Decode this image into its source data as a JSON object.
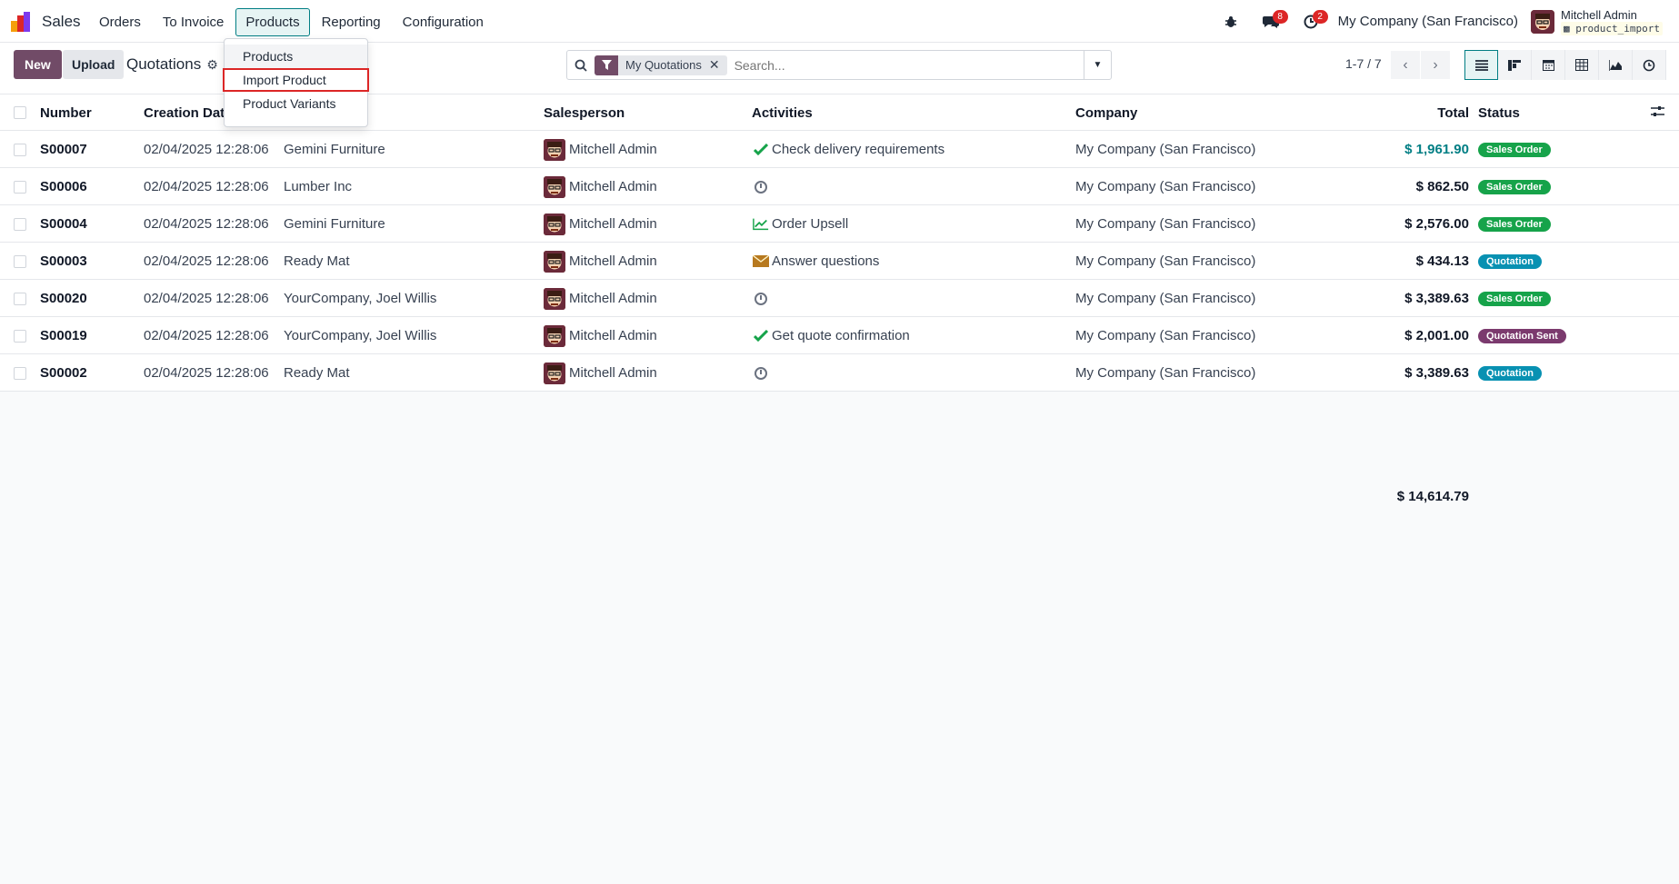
{
  "app": {
    "brand": "Sales"
  },
  "menu": [
    {
      "label": "Orders"
    },
    {
      "label": "To Invoice"
    },
    {
      "label": "Products"
    },
    {
      "label": "Reporting"
    },
    {
      "label": "Configuration"
    }
  ],
  "systray": {
    "messages_count": "8",
    "activities_count": "2",
    "company": "My Company (San Francisco)",
    "user_name": "Mitchell Admin",
    "db_name": "product_import"
  },
  "control": {
    "new_label": "New",
    "upload_label": "Upload",
    "breadcrumb": "Quotations",
    "facet_label": "My Quotations",
    "search_placeholder": "Search...",
    "pager": "1-7 / 7"
  },
  "dropdown": {
    "items": [
      {
        "label": "Products"
      },
      {
        "label": "Import Product"
      },
      {
        "label": "Product Variants"
      }
    ]
  },
  "table": {
    "columns": {
      "number": "Number",
      "creation_date": "Creation Date",
      "salesperson": "Salesperson",
      "activities": "Activities",
      "company": "Company",
      "total": "Total",
      "status": "Status"
    },
    "rows": [
      {
        "number": "S00007",
        "date": "02/04/2025 12:28:06",
        "customer": "Gemini Furniture",
        "salesperson": "Mitchell Admin",
        "activity_icon": "check-icon",
        "activity": "Check delivery requirements",
        "company": "My Company (San Francisco)",
        "total": "$ 1,961.90",
        "status": "Sales Order",
        "status_color": "#16a34a"
      },
      {
        "number": "S00006",
        "date": "02/04/2025 12:28:06",
        "customer": "Lumber Inc",
        "salesperson": "Mitchell Admin",
        "activity_icon": "clock-icon",
        "activity": "",
        "company": "My Company (San Francisco)",
        "total": "$ 862.50",
        "status": "Sales Order",
        "status_color": "#16a34a"
      },
      {
        "number": "S00004",
        "date": "02/04/2025 12:28:06",
        "customer": "Gemini Furniture",
        "salesperson": "Mitchell Admin",
        "activity_icon": "chart-line-icon",
        "activity": "Order Upsell",
        "company": "My Company (San Francisco)",
        "total": "$ 2,576.00",
        "status": "Sales Order",
        "status_color": "#16a34a"
      },
      {
        "number": "S00003",
        "date": "02/04/2025 12:28:06",
        "customer": "Ready Mat",
        "salesperson": "Mitchell Admin",
        "activity_icon": "envelope-icon",
        "activity": "Answer questions",
        "company": "My Company (San Francisco)",
        "total": "$ 434.13",
        "status": "Quotation",
        "status_color": "#0891b2"
      },
      {
        "number": "S00020",
        "date": "02/04/2025 12:28:06",
        "customer": "YourCompany, Joel Willis",
        "salesperson": "Mitchell Admin",
        "activity_icon": "clock-icon",
        "activity": "",
        "company": "My Company (San Francisco)",
        "total": "$ 3,389.63",
        "status": "Sales Order",
        "status_color": "#16a34a"
      },
      {
        "number": "S00019",
        "date": "02/04/2025 12:28:06",
        "customer": "YourCompany, Joel Willis",
        "salesperson": "Mitchell Admin",
        "activity_icon": "check-icon",
        "activity": "Get quote confirmation",
        "company": "My Company (San Francisco)",
        "total": "$ 2,001.00",
        "status": "Quotation Sent",
        "status_color": "#7b3a6e"
      },
      {
        "number": "S00002",
        "date": "02/04/2025 12:28:06",
        "customer": "Ready Mat",
        "salesperson": "Mitchell Admin",
        "activity_icon": "clock-icon",
        "activity": "",
        "company": "My Company (San Francisco)",
        "total": "$ 3,389.63",
        "status": "Quotation",
        "status_color": "#0891b2"
      }
    ],
    "grand_total": "$ 14,614.79"
  },
  "colors": {
    "brand": "#714b67",
    "accent": "#017e84",
    "highlight_outline": "#dc2626"
  }
}
